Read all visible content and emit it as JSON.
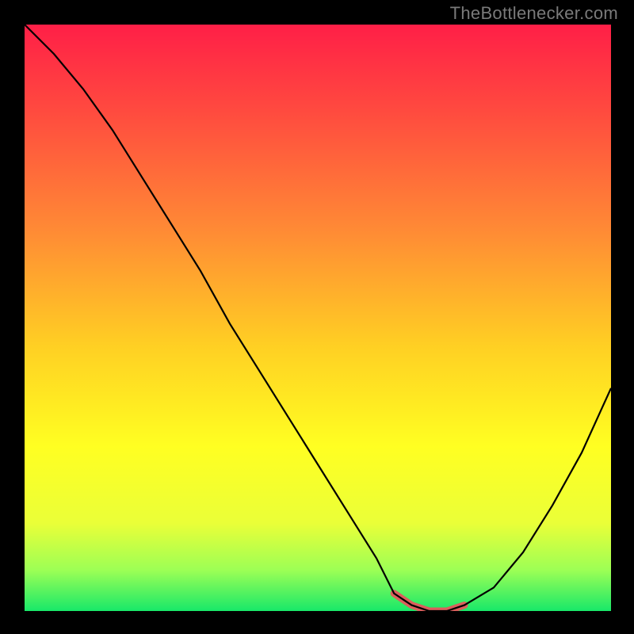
{
  "watermark": {
    "text": "TheBottlenecker.com"
  },
  "chart_data": {
    "type": "line",
    "title": "",
    "xlabel": "",
    "ylabel": "",
    "xlim": [
      0,
      100
    ],
    "ylim": [
      0,
      100
    ],
    "series": [
      {
        "name": "curve",
        "x": [
          0,
          5,
          10,
          15,
          20,
          25,
          30,
          35,
          40,
          45,
          50,
          55,
          60,
          63,
          66,
          69,
          72,
          75,
          80,
          85,
          90,
          95,
          100
        ],
        "y": [
          100,
          95,
          89,
          82,
          74,
          66,
          58,
          49,
          41,
          33,
          25,
          17,
          9,
          3,
          1,
          0,
          0,
          1,
          4,
          10,
          18,
          27,
          38
        ]
      }
    ],
    "gradient_stops": [
      {
        "pos": 0.0,
        "color": "#ff1f47"
      },
      {
        "pos": 0.15,
        "color": "#ff4b3f"
      },
      {
        "pos": 0.35,
        "color": "#ff8a35"
      },
      {
        "pos": 0.55,
        "color": "#ffd023"
      },
      {
        "pos": 0.72,
        "color": "#ffff22"
      },
      {
        "pos": 0.85,
        "color": "#eaff38"
      },
      {
        "pos": 0.93,
        "color": "#9dff55"
      },
      {
        "pos": 1.0,
        "color": "#18e869"
      }
    ],
    "highlight_segment": {
      "color": "#db5e5c",
      "width": 9,
      "x": [
        63,
        66,
        69,
        72,
        75
      ],
      "y": [
        3,
        1,
        0,
        0,
        1
      ]
    }
  }
}
